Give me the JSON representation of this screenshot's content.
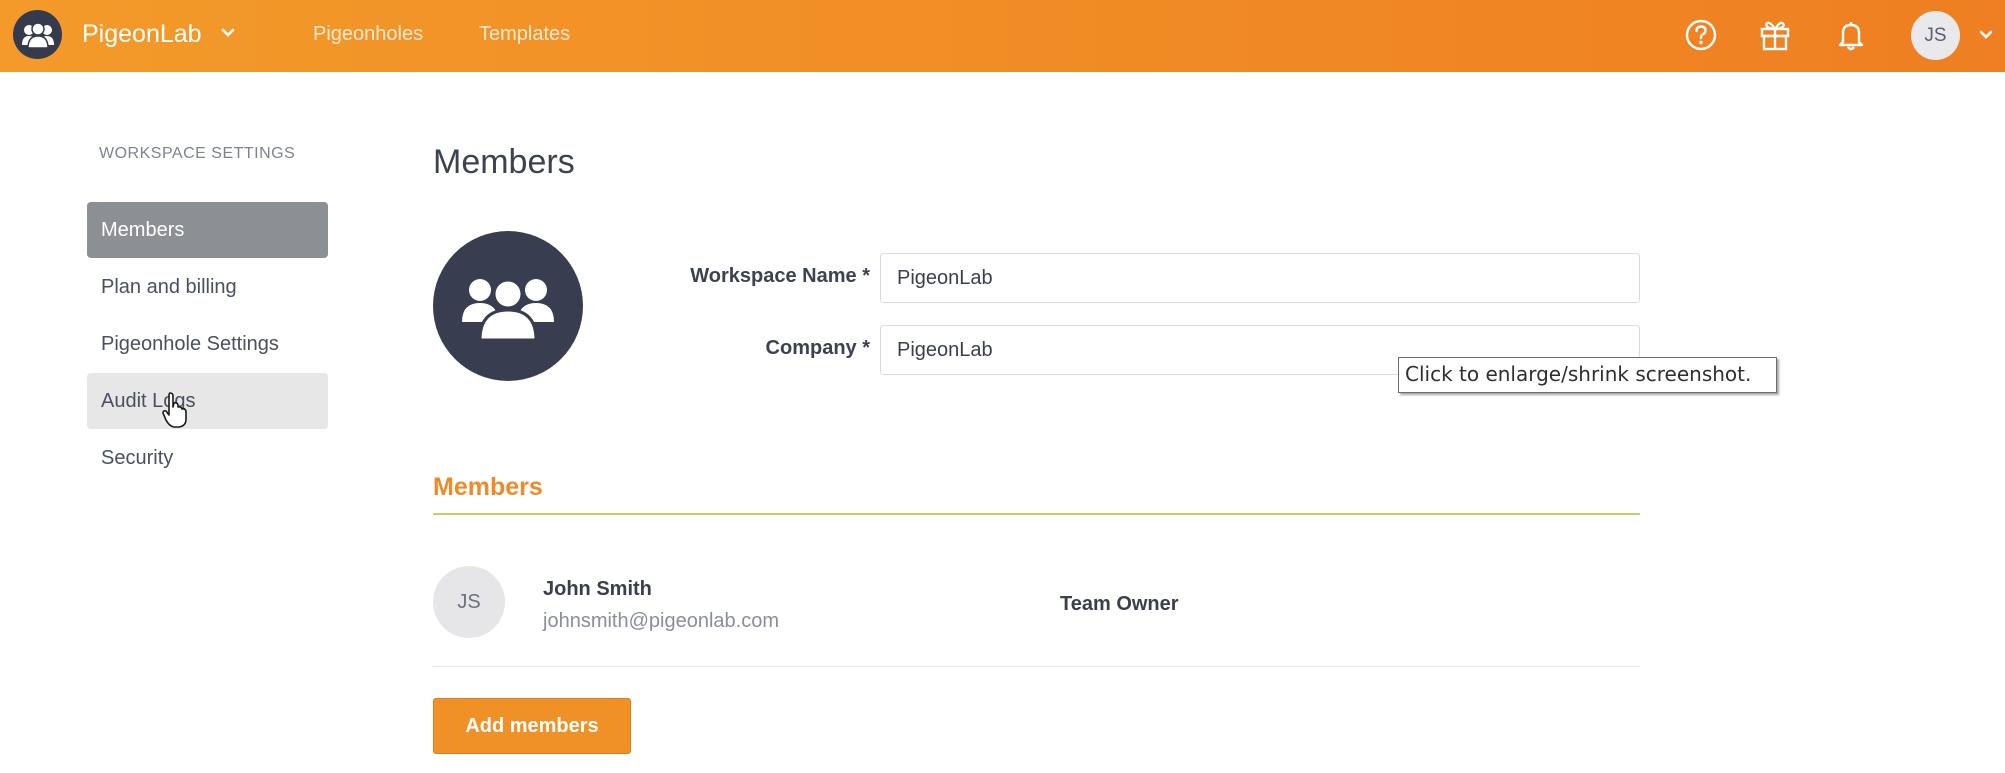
{
  "header": {
    "brand": "PigeonLab",
    "nav": [
      "Pigeonholes",
      "Templates"
    ],
    "user_initials": "JS",
    "icons": [
      "help-icon",
      "gift-icon",
      "bell-icon"
    ]
  },
  "sidebar": {
    "heading": "WORKSPACE SETTINGS",
    "items": [
      {
        "label": "Members",
        "state": "active"
      },
      {
        "label": "Plan and billing"
      },
      {
        "label": "Pigeonhole Settings"
      },
      {
        "label": "Audit Logs",
        "state": "hover"
      },
      {
        "label": "Security"
      }
    ]
  },
  "main": {
    "title": "Members",
    "form": {
      "workspace_label": "Workspace Name *",
      "workspace_value": "PigeonLab",
      "company_label": "Company *",
      "company_value": "PigeonLab"
    },
    "tooltip": "Click to enlarge/shrink screenshot.",
    "members_section": {
      "title": "Members",
      "rows": [
        {
          "initials": "JS",
          "name": "John Smith",
          "email": "johnsmith@pigeonlab.com",
          "role": "Team Owner"
        }
      ],
      "add_button": "Add members"
    }
  },
  "colors": {
    "header_orange": "#f08a24",
    "accent_orange": "#ef8a27",
    "active_sidebar": "#8c9094",
    "dark_avatar": "#383d50"
  }
}
